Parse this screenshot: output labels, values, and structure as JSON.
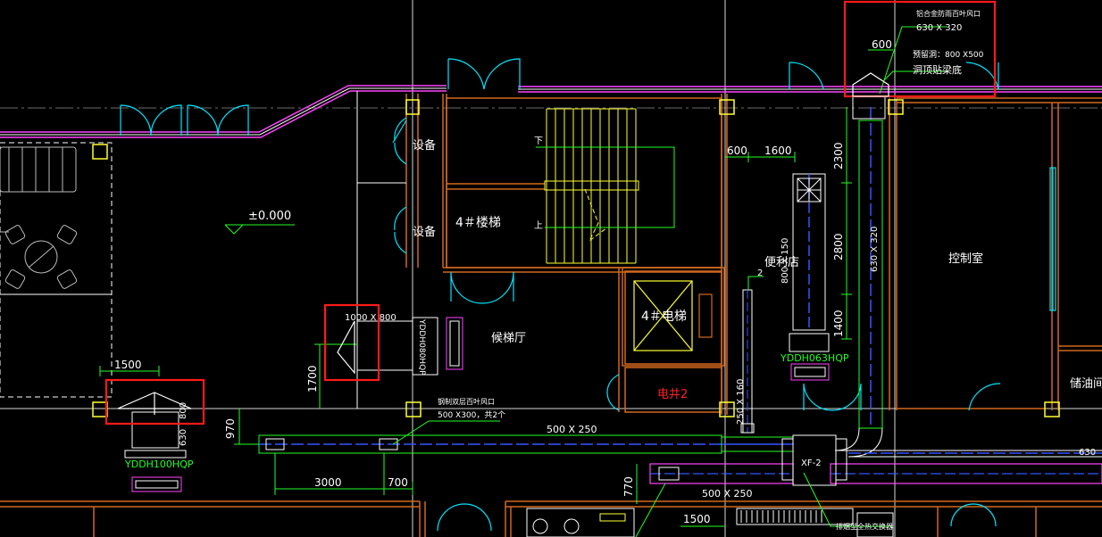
{
  "colors": {
    "background": "#000000",
    "wall_orange": "#d2691e",
    "wall_magenta": "#ff44ff",
    "door_cyan": "#00e5ff",
    "duct_blue": "#3355ff",
    "dim_green": "#22ff22",
    "text_white": "#ffffff",
    "highlight_red": "#ff1a1a",
    "column_yellow": "#ffff33"
  },
  "labels": {
    "equipment_1": "设备",
    "equipment_2": "设备",
    "elevation": "±0.000",
    "stair": "4＃楼梯",
    "stair_down": "下",
    "stair_up": "上",
    "elevator": "4＃电梯",
    "hall": "候梯厅",
    "store": "便利店",
    "control_room": "控制室",
    "oil_room": "储油间",
    "shaft": "电井2",
    "unit": "XF-2"
  },
  "dimensions": {
    "d600_top": "600",
    "d600": "600",
    "d1600": "1600",
    "d2300": "2300",
    "d2800": "2800",
    "d1400": "1400",
    "d1500_left": "1500",
    "d1700": "1700",
    "d970": "970",
    "d3000": "3000",
    "d700": "700",
    "d770": "770",
    "d1500_bottom": "1500",
    "d250x160": "250 X 160",
    "d800x150": "800 X 150",
    "d630x320_vert": "630 X 320",
    "d500x250_main": "500 X 250",
    "d500x250_low": "500 X 250",
    "d630_right": "630",
    "d1000x800": "1000 X 800",
    "d800_left": "800",
    "d630_left": "630",
    "callout_2": "2"
  },
  "equipment": {
    "fan_left": "YDDH100HQP",
    "fan_right": "YDDH063HQP",
    "fan_mid": "YDDH080HQP"
  },
  "annotations": {
    "louver_title": "铝合金防雨百叶风口",
    "louver_size": "630 X 320",
    "reserve_hole": "预留洞：800 X500",
    "hole_bottom": "洞顶贴梁底",
    "bottom_louver_title": "钢制双层百叶风口",
    "bottom_louver_size": "500 X300，共2个",
    "bottom_note": "排烟型全热交换器"
  }
}
